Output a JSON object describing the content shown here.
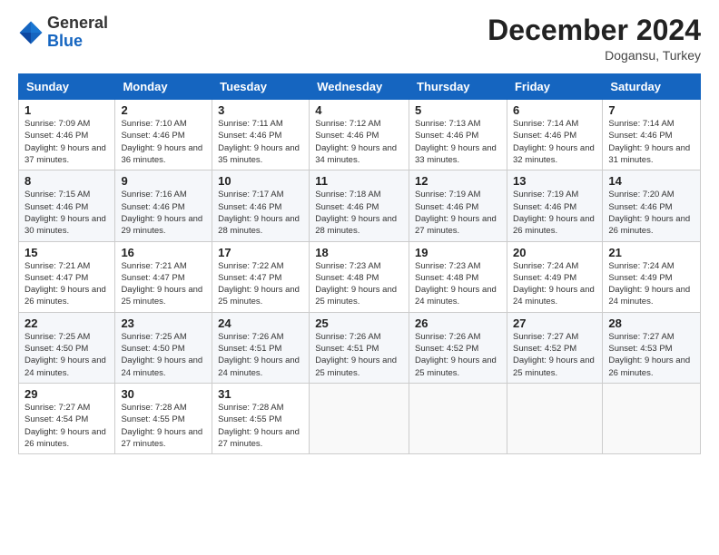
{
  "header": {
    "logo_line1": "General",
    "logo_line2": "Blue",
    "month_title": "December 2024",
    "location": "Dogansu, Turkey"
  },
  "weekdays": [
    "Sunday",
    "Monday",
    "Tuesday",
    "Wednesday",
    "Thursday",
    "Friday",
    "Saturday"
  ],
  "weeks": [
    [
      {
        "day": "1",
        "sunrise": "Sunrise: 7:09 AM",
        "sunset": "Sunset: 4:46 PM",
        "daylight": "Daylight: 9 hours and 37 minutes."
      },
      {
        "day": "2",
        "sunrise": "Sunrise: 7:10 AM",
        "sunset": "Sunset: 4:46 PM",
        "daylight": "Daylight: 9 hours and 36 minutes."
      },
      {
        "day": "3",
        "sunrise": "Sunrise: 7:11 AM",
        "sunset": "Sunset: 4:46 PM",
        "daylight": "Daylight: 9 hours and 35 minutes."
      },
      {
        "day": "4",
        "sunrise": "Sunrise: 7:12 AM",
        "sunset": "Sunset: 4:46 PM",
        "daylight": "Daylight: 9 hours and 34 minutes."
      },
      {
        "day": "5",
        "sunrise": "Sunrise: 7:13 AM",
        "sunset": "Sunset: 4:46 PM",
        "daylight": "Daylight: 9 hours and 33 minutes."
      },
      {
        "day": "6",
        "sunrise": "Sunrise: 7:14 AM",
        "sunset": "Sunset: 4:46 PM",
        "daylight": "Daylight: 9 hours and 32 minutes."
      },
      {
        "day": "7",
        "sunrise": "Sunrise: 7:14 AM",
        "sunset": "Sunset: 4:46 PM",
        "daylight": "Daylight: 9 hours and 31 minutes."
      }
    ],
    [
      {
        "day": "8",
        "sunrise": "Sunrise: 7:15 AM",
        "sunset": "Sunset: 4:46 PM",
        "daylight": "Daylight: 9 hours and 30 minutes."
      },
      {
        "day": "9",
        "sunrise": "Sunrise: 7:16 AM",
        "sunset": "Sunset: 4:46 PM",
        "daylight": "Daylight: 9 hours and 29 minutes."
      },
      {
        "day": "10",
        "sunrise": "Sunrise: 7:17 AM",
        "sunset": "Sunset: 4:46 PM",
        "daylight": "Daylight: 9 hours and 28 minutes."
      },
      {
        "day": "11",
        "sunrise": "Sunrise: 7:18 AM",
        "sunset": "Sunset: 4:46 PM",
        "daylight": "Daylight: 9 hours and 28 minutes."
      },
      {
        "day": "12",
        "sunrise": "Sunrise: 7:19 AM",
        "sunset": "Sunset: 4:46 PM",
        "daylight": "Daylight: 9 hours and 27 minutes."
      },
      {
        "day": "13",
        "sunrise": "Sunrise: 7:19 AM",
        "sunset": "Sunset: 4:46 PM",
        "daylight": "Daylight: 9 hours and 26 minutes."
      },
      {
        "day": "14",
        "sunrise": "Sunrise: 7:20 AM",
        "sunset": "Sunset: 4:46 PM",
        "daylight": "Daylight: 9 hours and 26 minutes."
      }
    ],
    [
      {
        "day": "15",
        "sunrise": "Sunrise: 7:21 AM",
        "sunset": "Sunset: 4:47 PM",
        "daylight": "Daylight: 9 hours and 26 minutes."
      },
      {
        "day": "16",
        "sunrise": "Sunrise: 7:21 AM",
        "sunset": "Sunset: 4:47 PM",
        "daylight": "Daylight: 9 hours and 25 minutes."
      },
      {
        "day": "17",
        "sunrise": "Sunrise: 7:22 AM",
        "sunset": "Sunset: 4:47 PM",
        "daylight": "Daylight: 9 hours and 25 minutes."
      },
      {
        "day": "18",
        "sunrise": "Sunrise: 7:23 AM",
        "sunset": "Sunset: 4:48 PM",
        "daylight": "Daylight: 9 hours and 25 minutes."
      },
      {
        "day": "19",
        "sunrise": "Sunrise: 7:23 AM",
        "sunset": "Sunset: 4:48 PM",
        "daylight": "Daylight: 9 hours and 24 minutes."
      },
      {
        "day": "20",
        "sunrise": "Sunrise: 7:24 AM",
        "sunset": "Sunset: 4:49 PM",
        "daylight": "Daylight: 9 hours and 24 minutes."
      },
      {
        "day": "21",
        "sunrise": "Sunrise: 7:24 AM",
        "sunset": "Sunset: 4:49 PM",
        "daylight": "Daylight: 9 hours and 24 minutes."
      }
    ],
    [
      {
        "day": "22",
        "sunrise": "Sunrise: 7:25 AM",
        "sunset": "Sunset: 4:50 PM",
        "daylight": "Daylight: 9 hours and 24 minutes."
      },
      {
        "day": "23",
        "sunrise": "Sunrise: 7:25 AM",
        "sunset": "Sunset: 4:50 PM",
        "daylight": "Daylight: 9 hours and 24 minutes."
      },
      {
        "day": "24",
        "sunrise": "Sunrise: 7:26 AM",
        "sunset": "Sunset: 4:51 PM",
        "daylight": "Daylight: 9 hours and 24 minutes."
      },
      {
        "day": "25",
        "sunrise": "Sunrise: 7:26 AM",
        "sunset": "Sunset: 4:51 PM",
        "daylight": "Daylight: 9 hours and 25 minutes."
      },
      {
        "day": "26",
        "sunrise": "Sunrise: 7:26 AM",
        "sunset": "Sunset: 4:52 PM",
        "daylight": "Daylight: 9 hours and 25 minutes."
      },
      {
        "day": "27",
        "sunrise": "Sunrise: 7:27 AM",
        "sunset": "Sunset: 4:52 PM",
        "daylight": "Daylight: 9 hours and 25 minutes."
      },
      {
        "day": "28",
        "sunrise": "Sunrise: 7:27 AM",
        "sunset": "Sunset: 4:53 PM",
        "daylight": "Daylight: 9 hours and 26 minutes."
      }
    ],
    [
      {
        "day": "29",
        "sunrise": "Sunrise: 7:27 AM",
        "sunset": "Sunset: 4:54 PM",
        "daylight": "Daylight: 9 hours and 26 minutes."
      },
      {
        "day": "30",
        "sunrise": "Sunrise: 7:28 AM",
        "sunset": "Sunset: 4:55 PM",
        "daylight": "Daylight: 9 hours and 27 minutes."
      },
      {
        "day": "31",
        "sunrise": "Sunrise: 7:28 AM",
        "sunset": "Sunset: 4:55 PM",
        "daylight": "Daylight: 9 hours and 27 minutes."
      },
      null,
      null,
      null,
      null
    ]
  ]
}
